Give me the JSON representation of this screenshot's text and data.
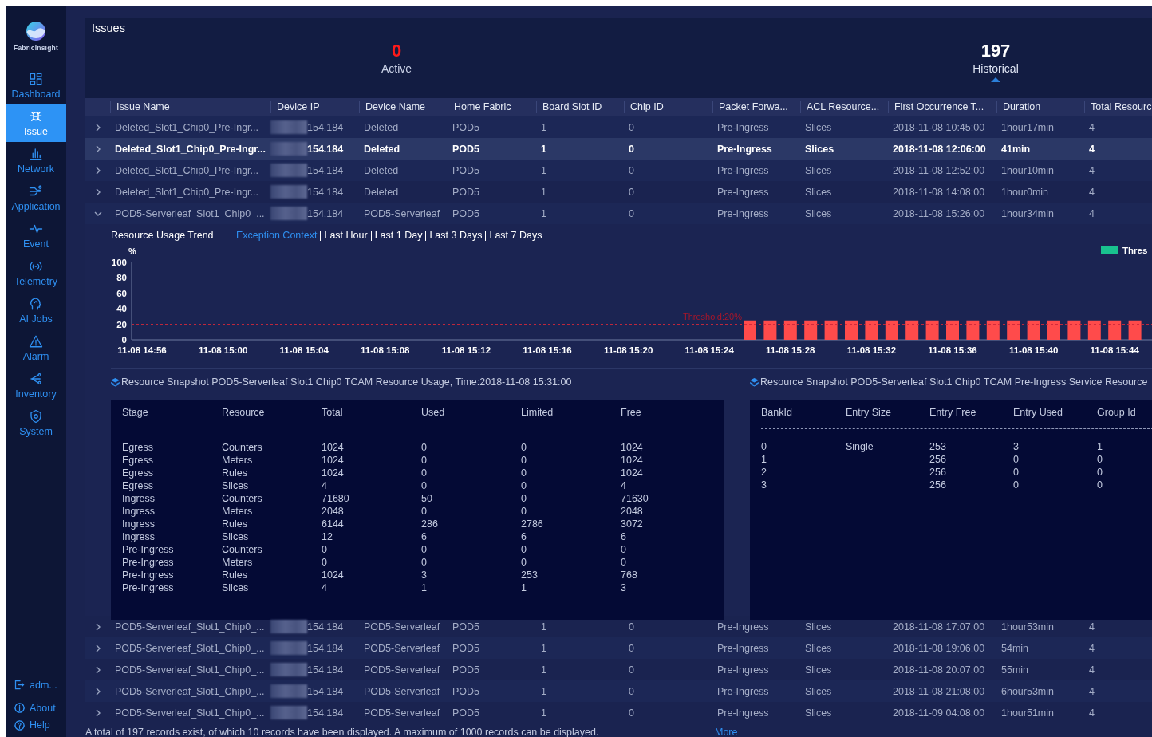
{
  "sidebar": {
    "logo_text": "FabricInsight",
    "items": [
      {
        "label": "Dashboard",
        "selected": false
      },
      {
        "label": "Issue",
        "selected": true
      },
      {
        "label": "Network",
        "selected": false
      },
      {
        "label": "Application",
        "selected": false
      },
      {
        "label": "Event",
        "selected": false
      },
      {
        "label": "Telemetry",
        "selected": false
      },
      {
        "label": "AI Jobs",
        "selected": false
      },
      {
        "label": "Alarm",
        "selected": false
      },
      {
        "label": "Inventory",
        "selected": false
      },
      {
        "label": "System",
        "selected": false
      }
    ],
    "footer_items": [
      {
        "label": "adm..."
      },
      {
        "label": "About"
      },
      {
        "label": "Help"
      }
    ]
  },
  "issues": {
    "title": "Issues",
    "stats": [
      {
        "value": "0",
        "label": "Active",
        "color": "#ff1a1a",
        "selected": false
      },
      {
        "value": "197",
        "label": "Historical",
        "color": "#ffffff",
        "selected": true
      }
    ]
  },
  "issues_table": {
    "columns": [
      "Issue Name",
      "Device IP",
      "Device Name",
      "Home Fabric",
      "Board Slot ID",
      "Chip ID",
      "Packet Forwa...",
      "ACL Resource...",
      "First Occurrence T...",
      "Duration",
      "Total Resourc"
    ],
    "rows": [
      {
        "expanded": false,
        "selected": false,
        "cells": [
          "Deleted_Slot1_Chip0_Pre-Ingr...",
          "154.184",
          "Deleted",
          "POD5",
          "1",
          "0",
          "Pre-Ingress",
          "Slices",
          "2018-11-08 10:45:00",
          "1hour17min",
          "4"
        ]
      },
      {
        "expanded": false,
        "selected": true,
        "cells": [
          "Deleted_Slot1_Chip0_Pre-Ingr...",
          "154.184",
          "Deleted",
          "POD5",
          "1",
          "0",
          "Pre-Ingress",
          "Slices",
          "2018-11-08 12:06:00",
          "41min",
          "4"
        ]
      },
      {
        "expanded": false,
        "selected": false,
        "cells": [
          "Deleted_Slot1_Chip0_Pre-Ingr...",
          "154.184",
          "Deleted",
          "POD5",
          "1",
          "0",
          "Pre-Ingress",
          "Slices",
          "2018-11-08 12:52:00",
          "1hour10min",
          "4"
        ]
      },
      {
        "expanded": false,
        "selected": false,
        "cells": [
          "Deleted_Slot1_Chip0_Pre-Ingr...",
          "154.184",
          "Deleted",
          "POD5",
          "1",
          "0",
          "Pre-Ingress",
          "Slices",
          "2018-11-08 14:08:00",
          "1hour0min",
          "4"
        ]
      },
      {
        "expanded": true,
        "selected": false,
        "cells": [
          "POD5-Serverleaf_Slot1_Chip0_...",
          "154.184",
          "POD5-Serverleaf",
          "POD5",
          "1",
          "0",
          "Pre-Ingress",
          "Slices",
          "2018-11-08 15:26:00",
          "1hour34min",
          "4"
        ],
        "detail": {
          "trend": {
            "title": "Resource Usage Trend",
            "ranges": [
              {
                "label": "Exception Context",
                "selected": true
              },
              {
                "label": "Last Hour",
                "selected": false
              },
              {
                "label": "Last 1 Day",
                "selected": false
              },
              {
                "label": "Last 3 Days",
                "selected": false
              },
              {
                "label": "Last 7 Days",
                "selected": false
              }
            ],
            "legend": [
              {
                "label": "Thres",
                "color": "#19c28f"
              }
            ],
            "chart_data": {
              "type": "bar",
              "ylabel": "%",
              "ylim": [
                0,
                100
              ],
              "yticks": [
                0,
                20,
                40,
                60,
                80,
                100
              ],
              "categories": [
                "11-08 14:56",
                null,
                null,
                null,
                "11-08 15:00",
                null,
                null,
                null,
                "11-08 15:04",
                null,
                null,
                null,
                "11-08 15:08",
                null,
                null,
                null,
                "11-08 15:12",
                null,
                null,
                null,
                "11-08 15:16",
                null,
                null,
                null,
                "11-08 15:20",
                null,
                null,
                null,
                "11-08 15:24",
                null,
                null,
                null,
                "11-08 15:28",
                null,
                null,
                null,
                "11-08 15:32",
                null,
                null,
                null,
                "11-08 15:36",
                null,
                null,
                null,
                "11-08 15:40",
                null,
                null,
                null,
                "11-08 15:44",
                null
              ],
              "values": [
                null,
                null,
                null,
                null,
                null,
                null,
                null,
                null,
                null,
                null,
                null,
                null,
                null,
                null,
                null,
                null,
                null,
                null,
                null,
                null,
                null,
                null,
                null,
                null,
                null,
                null,
                null,
                null,
                null,
                null,
                25,
                25,
                25,
                25,
                25,
                25,
                25,
                25,
                25,
                25,
                25,
                25,
                25,
                25,
                25,
                25,
                25,
                25,
                25,
                25
              ],
              "ref_lines": [
                {
                  "axis": "y",
                  "value": 20,
                  "label": "Threshold:20%"
                }
              ]
            }
          },
          "usage_snapshot": {
            "title": "Resource Snapshot POD5-Serverleaf Slot1 Chip0 TCAM Resource Usage, Time:2018-11-08 15:31:00",
            "columns": [
              "Stage",
              "Resource",
              "Total",
              "Used",
              "Limited",
              "Free"
            ],
            "rows": [
              [
                "Egress",
                "Counters",
                "1024",
                "0",
                "0",
                "1024"
              ],
              [
                "Egress",
                "Meters",
                "1024",
                "0",
                "0",
                "1024"
              ],
              [
                "Egress",
                "Rules",
                "1024",
                "0",
                "0",
                "1024"
              ],
              [
                "Egress",
                "Slices",
                "4",
                "0",
                "0",
                "4"
              ],
              [
                "Ingress",
                "Counters",
                "71680",
                "50",
                "0",
                "71630"
              ],
              [
                "Ingress",
                "Meters",
                "2048",
                "0",
                "0",
                "2048"
              ],
              [
                "Ingress",
                "Rules",
                "6144",
                "286",
                "2786",
                "3072"
              ],
              [
                "Ingress",
                "Slices",
                "12",
                "6",
                "6",
                "6"
              ],
              [
                "Pre-Ingress",
                "Counters",
                "0",
                "0",
                "0",
                "0"
              ],
              [
                "Pre-Ingress",
                "Meters",
                "0",
                "0",
                "0",
                "0"
              ],
              [
                "Pre-Ingress",
                "Rules",
                "1024",
                "3",
                "253",
                "768"
              ],
              [
                "Pre-Ingress",
                "Slices",
                "4",
                "1",
                "1",
                "3"
              ]
            ]
          },
          "service_snapshot": {
            "title": "Resource Snapshot POD5-Serverleaf Slot1 Chip0 TCAM Pre-Ingress Service Resource",
            "columns": [
              "BankId",
              "Entry Size",
              "Entry Free",
              "Entry Used",
              "Group Id"
            ],
            "rows": [
              {
                "bank_id": "0",
                "entry_size": "Single",
                "entry_free": "253",
                "entry_used": "3",
                "group_id": "1"
              },
              {
                "bank_id": "1",
                "entry_free": "256",
                "entry_used": "0",
                "group_id": "0"
              },
              {
                "bank_id": "2",
                "entry_free": "256",
                "entry_used": "0",
                "group_id": "0"
              },
              {
                "bank_id": "3",
                "entry_free": "256",
                "entry_used": "0",
                "group_id": "0"
              }
            ]
          }
        }
      },
      {
        "expanded": false,
        "selected": false,
        "cells": [
          "POD5-Serverleaf_Slot1_Chip0_...",
          "154.184",
          "POD5-Serverleaf",
          "POD5",
          "1",
          "0",
          "Pre-Ingress",
          "Slices",
          "2018-11-08 17:07:00",
          "1hour53min",
          "4"
        ]
      },
      {
        "expanded": false,
        "selected": false,
        "cells": [
          "POD5-Serverleaf_Slot1_Chip0_...",
          "154.184",
          "POD5-Serverleaf",
          "POD5",
          "1",
          "0",
          "Pre-Ingress",
          "Slices",
          "2018-11-08 19:06:00",
          "54min",
          "4"
        ]
      },
      {
        "expanded": false,
        "selected": false,
        "cells": [
          "POD5-Serverleaf_Slot1_Chip0_...",
          "154.184",
          "POD5-Serverleaf",
          "POD5",
          "1",
          "0",
          "Pre-Ingress",
          "Slices",
          "2018-11-08 20:07:00",
          "55min",
          "4"
        ]
      },
      {
        "expanded": false,
        "selected": false,
        "cells": [
          "POD5-Serverleaf_Slot1_Chip0_...",
          "154.184",
          "POD5-Serverleaf",
          "POD5",
          "1",
          "0",
          "Pre-Ingress",
          "Slices",
          "2018-11-08 21:08:00",
          "6hour53min",
          "4"
        ]
      },
      {
        "expanded": false,
        "selected": false,
        "cells": [
          "POD5-Serverleaf_Slot1_Chip0_...",
          "154.184",
          "POD5-Serverleaf",
          "POD5",
          "1",
          "0",
          "Pre-Ingress",
          "Slices",
          "2018-11-09 04:08:00",
          "1hour51min",
          "4"
        ]
      }
    ]
  },
  "footer": {
    "text": "A total of 197 records exist, of which 10 records have been displayed. A maximum of 1000 records can be displayed.",
    "link": "More"
  }
}
